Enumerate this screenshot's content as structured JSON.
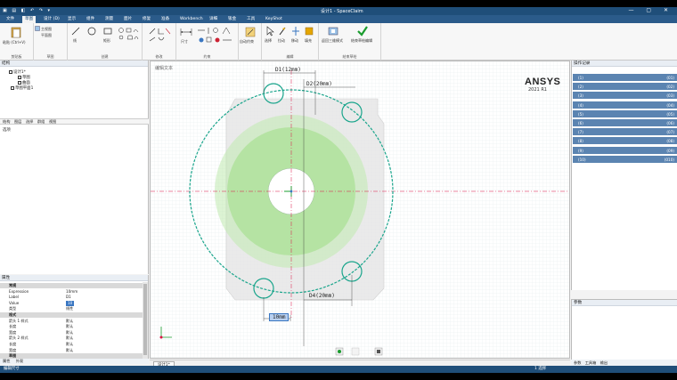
{
  "window": {
    "title": "设计1 - SpaceClaim",
    "quick_access": "▣ ▤ ◧ ↶ ↷ ▾",
    "controls": "— ▢ ✕"
  },
  "menu_tabs": [
    "文件",
    "草图",
    "设计 (D)",
    "显示",
    "组件",
    "测量",
    "面片",
    "修复",
    "准备",
    "Workbench",
    "详细",
    "钣金",
    "工具",
    "KeyShot"
  ],
  "ribbon": {
    "groups": [
      {
        "label": "剪贴板"
      },
      {
        "label": "草图"
      },
      {
        "label": "创建"
      },
      {
        "label": "修改"
      },
      {
        "label": "约束"
      },
      {
        "label": "编辑"
      },
      {
        "label": "结束草绘"
      }
    ],
    "paste": "粘贴 (Ctrl+V)",
    "plane_btn": "主视图",
    "plane_btn2": "平面图",
    "line": "线",
    "rect": "矩形",
    "dimension": "尺寸",
    "auto_constrain": "自动约束",
    "select": "选择",
    "pull": "拉动",
    "move": "移动",
    "fill": "填充",
    "return_3d": "返回三维模式",
    "finish": "结束草绘编辑"
  },
  "structure": {
    "title": "结构",
    "items": [
      "设计1*",
      "草图",
      "曲面",
      "草图平面1"
    ],
    "tabs": [
      "结构",
      "图层",
      "选择",
      "群组",
      "视图"
    ],
    "options_label": "选项"
  },
  "properties": {
    "title": "属性",
    "rows": [
      {
        "section": true,
        "k": "常规",
        "v": ""
      },
      {
        "k": "Expression",
        "v": "10mm"
      },
      {
        "k": "Label",
        "v": "D1"
      },
      {
        "k": "Value",
        "v": "10",
        "sel": true
      },
      {
        "k": "类型",
        "v": "线性"
      },
      {
        "section": true,
        "k": "格式",
        "v": ""
      },
      {
        "k": "箭头 1 样式",
        "v": "默认"
      },
      {
        "k": "长度",
        "v": "默认"
      },
      {
        "k": "宽度",
        "v": "默认"
      },
      {
        "k": "箭头 2 样式",
        "v": "默认"
      },
      {
        "k": "长度",
        "v": "默认"
      },
      {
        "k": "宽度",
        "v": "默认"
      },
      {
        "section": true,
        "k": "草图",
        "v": ""
      }
    ],
    "tabs": [
      "属性",
      "外观"
    ]
  },
  "canvas": {
    "edit_label": "编辑文本",
    "brand": "ANSYS",
    "version": "2021 R1",
    "dim_top": "D1(12mm)",
    "dim_top2": "D2(20mm)",
    "dim_bottom_right": "D4(20mm)",
    "dim_edit": "10mm",
    "tab": "设计1*"
  },
  "history": {
    "title": "操作记录",
    "rows": [
      {
        "name": "(1)",
        "count": "(01)"
      },
      {
        "name": "(2)",
        "count": "(02)"
      },
      {
        "name": "(3)",
        "count": "(03)"
      },
      {
        "name": "(4)",
        "count": "(04)"
      },
      {
        "name": "(5)",
        "count": "(05)"
      },
      {
        "name": "(6)",
        "count": "(06)"
      },
      {
        "name": "(7)",
        "count": "(07)"
      },
      {
        "name": "(8)",
        "count": "(08)"
      },
      {
        "name": "(9)",
        "count": "(09)"
      },
      {
        "name": "(10)",
        "count": "(010)"
      }
    ]
  },
  "params": {
    "title": "参数",
    "tabs": [
      "参数",
      "工具箱",
      "输出"
    ]
  },
  "status": {
    "left": "编辑尺寸",
    "right": "1 选择"
  },
  "colors": {
    "accent": "#1f4e79",
    "circle": "#1aa58c",
    "fill": "#b5e6a4"
  }
}
